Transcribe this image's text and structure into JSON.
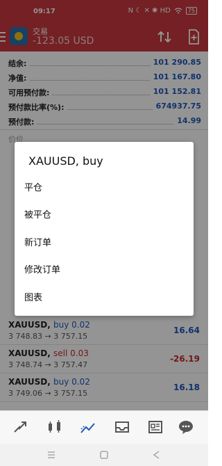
{
  "status": {
    "time": "09:17",
    "icons_text": "N ☾ ✕ ✱ HD",
    "battery": "75"
  },
  "appbar": {
    "title": "交易",
    "subtitle": "-123.05 USD"
  },
  "summary": [
    {
      "label": "结余:",
      "value": "101 290.85"
    },
    {
      "label": "净值:",
      "value": "101 167.80"
    },
    {
      "label": "可用预付款:",
      "value": "101 152.81"
    },
    {
      "label": "预付款比率(%):",
      "value": "674937.75"
    },
    {
      "label": "预付款:",
      "value": "14.99"
    }
  ],
  "section_label": "价位",
  "positions": [
    {
      "symbol": "XAUUSD,",
      "dir": "buy 0.02",
      "prices": "3 748.83 → 3 757.15",
      "pl": "16.64"
    },
    {
      "symbol": "XAUUSD,",
      "dir": "sell 0.03",
      "prices": "3 748.74 → 3 757.47",
      "pl": "-26.19"
    },
    {
      "symbol": "XAUUSD,",
      "dir": "buy 0.02",
      "prices": "3 749.06 → 3 757.15",
      "pl": "16.18"
    }
  ],
  "dialog": {
    "title": "XAUUSD, buy",
    "items": [
      "平仓",
      "被平仓",
      "新订单",
      "修改订单",
      "图表"
    ]
  }
}
